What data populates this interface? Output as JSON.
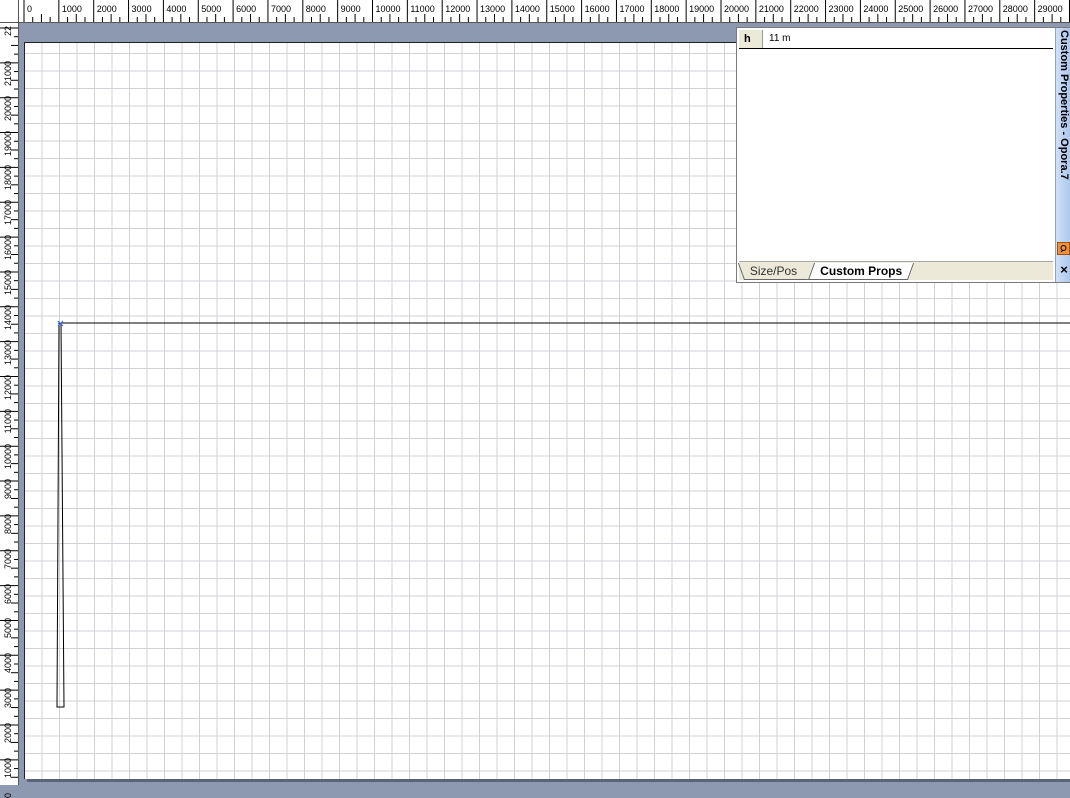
{
  "ruler": {
    "horizontal_labels": [
      "0",
      "1000",
      "2000",
      "3000",
      "4000",
      "5000",
      "6000",
      "7000",
      "8000",
      "9000",
      "10000",
      "11000",
      "12000",
      "13000",
      "14000",
      "15000",
      "16000",
      "17000",
      "18000",
      "19000",
      "20000",
      "21000",
      "22000",
      "23000",
      "24000",
      "25000",
      "26000",
      "27000",
      "28000",
      "29000"
    ],
    "vertical_labels": [
      "22",
      "21000",
      "20000",
      "19000",
      "18000",
      "17000",
      "16000",
      "15000",
      "14000",
      "13000",
      "12000",
      "11000",
      "10000",
      "9000",
      "8000",
      "7000",
      "6000",
      "5000",
      "4000",
      "3000",
      "2000",
      "1000",
      "0"
    ]
  },
  "custom_properties_panel": {
    "title": "Custom Properties - Opora.7",
    "properties": [
      {
        "name": "h",
        "value": "11 m"
      }
    ],
    "tabs": [
      {
        "label": "Size/Pos",
        "active": false
      },
      {
        "label": "Custom Props",
        "active": true
      }
    ],
    "close_symbol": "×"
  },
  "colors": {
    "workspace_background": "#8d99b0",
    "grid_line": "#cfd3d8",
    "panel_title_gradient": "#a9c4ec",
    "pin_icon": "#f0903a",
    "selection_marker": "#4a6fd8"
  }
}
